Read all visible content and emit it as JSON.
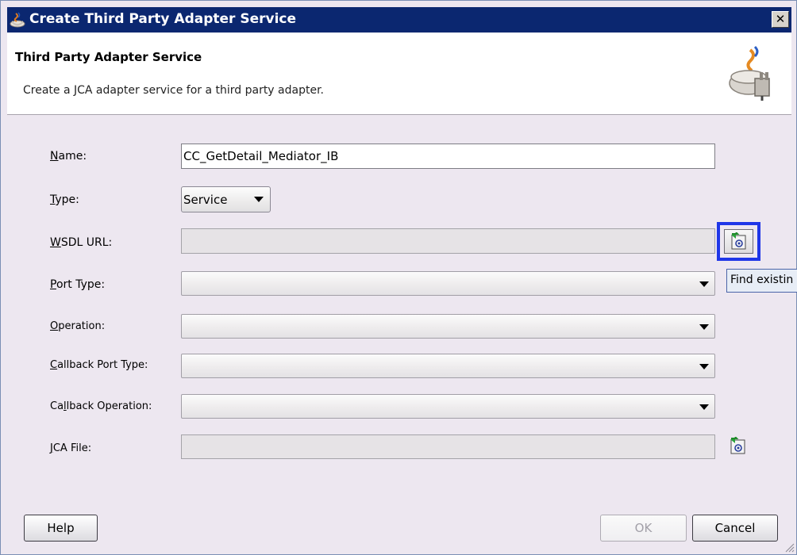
{
  "window": {
    "title": "Create Third Party Adapter Service",
    "close_glyph": "✕"
  },
  "header": {
    "title": "Third Party Adapter Service",
    "description": "Create a JCA adapter service for a third party adapter.",
    "logo_icon": "adapter-cup-plug-icon"
  },
  "form": {
    "name": {
      "label_mnemonic": "N",
      "label_rest": "ame:",
      "value": "CC_GetDetail_Mediator_IB"
    },
    "type": {
      "label_mnemonic": "T",
      "label_rest": "ype:",
      "value": "Service"
    },
    "wsdl_url": {
      "label_mnemonic": "W",
      "label_rest": "SDL URL:",
      "value": ""
    },
    "port_type": {
      "label_mnemonic": "P",
      "label_rest": "ort Type:",
      "value": ""
    },
    "operation": {
      "label_mnemonic": "O",
      "label_rest": "peration:",
      "value": ""
    },
    "callback_port_type": {
      "label_mnemonic": "C",
      "label_rest": "allback Port Type:",
      "value": ""
    },
    "callback_operation": {
      "label_before": "Ca",
      "label_mnemonic": "l",
      "label_rest": "lback Operation:",
      "value": ""
    },
    "jca_file": {
      "label_mnemonic": "J",
      "label_rest": "CA File:",
      "value": ""
    }
  },
  "tooltip": {
    "text": "Find existin"
  },
  "buttons": {
    "help": "Help",
    "ok": "OK",
    "cancel": "Cancel"
  },
  "colors": {
    "titlebar": "#0b2770",
    "dialog_bg": "#ede7f0",
    "highlight_frame": "#1f36e8"
  }
}
